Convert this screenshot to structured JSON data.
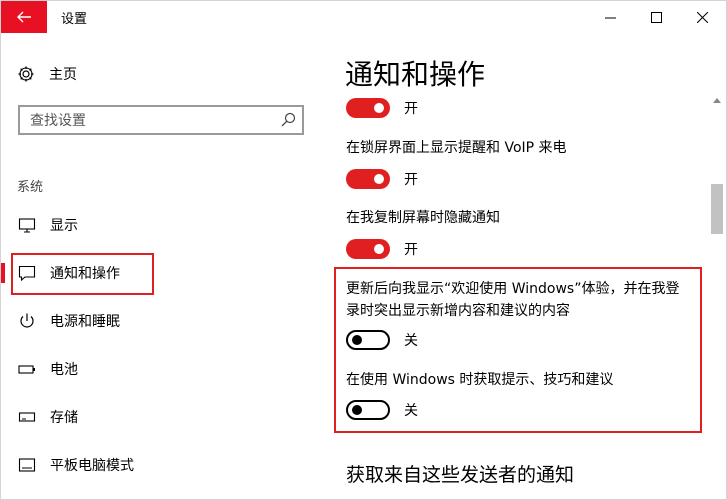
{
  "window": {
    "title": "设置",
    "back_icon": "arrow-left-icon",
    "controls": [
      "minimize-icon",
      "maximize-icon",
      "close-icon"
    ],
    "accent_color": "#e81123"
  },
  "sidebar": {
    "home": {
      "label": "主页",
      "icon": "gear-icon"
    },
    "search": {
      "placeholder": "查找设置",
      "value": "",
      "icon": "search-icon"
    },
    "group_label": "系统",
    "items": [
      {
        "label": "显示",
        "icon": "monitor-icon",
        "active": false
      },
      {
        "label": "通知和操作",
        "icon": "notification-icon",
        "active": true
      },
      {
        "label": "电源和睡眠",
        "icon": "power-icon",
        "active": false
      },
      {
        "label": "电池",
        "icon": "battery-icon",
        "active": false
      },
      {
        "label": "存储",
        "icon": "storage-icon",
        "active": false
      },
      {
        "label": "平板电脑模式",
        "icon": "tablet-icon",
        "active": false
      }
    ]
  },
  "main": {
    "title": "通知和操作",
    "settings": [
      {
        "label": "",
        "state": "开",
        "on": true
      },
      {
        "label": "在锁屏界面上显示提醒和 VoIP 来电",
        "state": "开",
        "on": true
      },
      {
        "label": "在我复制屏幕时隐藏通知",
        "state": "开",
        "on": true
      },
      {
        "label_line1": "更新后向我显示“欢迎使用 Windows”体验，并在我登",
        "label_line2": "录时突出显示新增内容和建议的内容",
        "state": "关",
        "on": false
      },
      {
        "label": "在使用 Windows 时获取提示、技巧和建议",
        "state": "关",
        "on": false
      }
    ],
    "section_title": "获取来自这些发送者的通知"
  }
}
